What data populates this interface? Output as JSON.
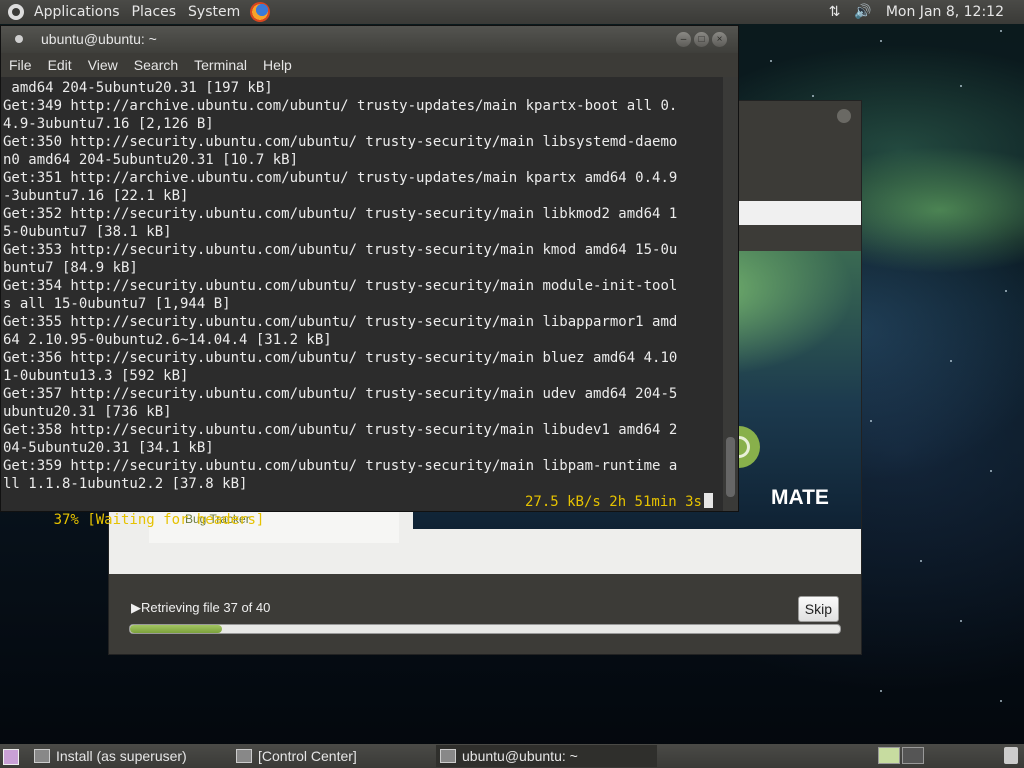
{
  "top_panel": {
    "menus": [
      "Applications",
      "Places",
      "System"
    ],
    "clock": "Mon Jan 8, 12:12"
  },
  "terminal": {
    "title": "ubuntu@ubuntu: ~",
    "menu": [
      "File",
      "Edit",
      "View",
      "Search",
      "Terminal",
      "Help"
    ],
    "lines": [
      " amd64 204-5ubuntu20.31 [197 kB]",
      "Get:349 http://archive.ubuntu.com/ubuntu/ trusty-updates/main kpartx-boot all 0.",
      "4.9-3ubuntu7.16 [2,126 B]",
      "Get:350 http://security.ubuntu.com/ubuntu/ trusty-security/main libsystemd-daemo",
      "n0 amd64 204-5ubuntu20.31 [10.7 kB]",
      "Get:351 http://archive.ubuntu.com/ubuntu/ trusty-updates/main kpartx amd64 0.4.9",
      "-3ubuntu7.16 [22.1 kB]",
      "Get:352 http://security.ubuntu.com/ubuntu/ trusty-security/main libkmod2 amd64 1",
      "5-0ubuntu7 [38.1 kB]",
      "Get:353 http://security.ubuntu.com/ubuntu/ trusty-security/main kmod amd64 15-0u",
      "buntu7 [84.9 kB]",
      "Get:354 http://security.ubuntu.com/ubuntu/ trusty-security/main module-init-tool",
      "s all 15-0ubuntu7 [1,944 B]",
      "Get:355 http://security.ubuntu.com/ubuntu/ trusty-security/main libapparmor1 amd",
      "64 2.10.95-0ubuntu2.6~14.04.4 [31.2 kB]",
      "Get:356 http://security.ubuntu.com/ubuntu/ trusty-security/main bluez amd64 4.10",
      "1-0ubuntu13.3 [592 kB]",
      "Get:357 http://security.ubuntu.com/ubuntu/ trusty-security/main udev amd64 204-5",
      "ubuntu20.31 [736 kB]",
      "Get:358 http://security.ubuntu.com/ubuntu/ trusty-security/main libudev1 amd64 2",
      "04-5ubuntu20.31 [34.1 kB]",
      "Get:359 http://security.ubuntu.com/ubuntu/ trusty-security/main libpam-runtime a",
      "ll 1.1.8-1ubuntu2.2 [37.8 kB]"
    ],
    "status_left": "37% [Waiting for headers]",
    "status_right": "27.5 kB/s 2h 51min 3s"
  },
  "installer": {
    "slide_text": "MATE",
    "sidebar_link": "Bug Tracker",
    "progress_text": "Retrieving file 37 of 40",
    "skip_label": "Skip",
    "progress_fraction": 0.13
  },
  "taskbar": {
    "tasks": [
      "Install (as superuser)",
      "[Control Center]",
      "ubuntu@ubuntu: ~"
    ]
  }
}
